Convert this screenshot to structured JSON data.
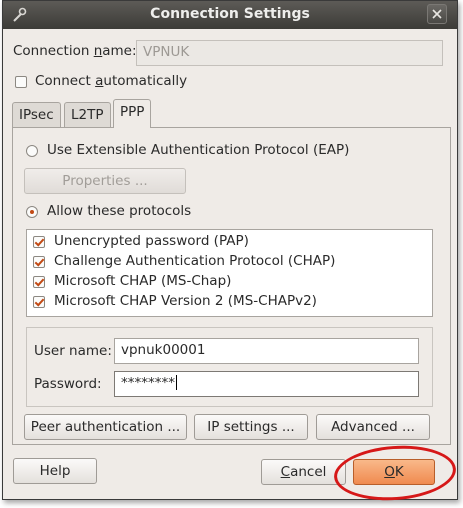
{
  "window": {
    "title": "Connection Settings",
    "title_icon": "tool-icon",
    "close_icon": "close-icon"
  },
  "connection_name": {
    "label_pre": "Connection ",
    "label_ul": "n",
    "label_post": "ame:",
    "value": "VPNUK"
  },
  "connect_auto": {
    "label_pre": "Connect ",
    "label_ul": "a",
    "label_post": "utomatically",
    "checked": false
  },
  "tabs": [
    {
      "label": "IPsec",
      "active": false
    },
    {
      "label": "L2TP",
      "active": false
    },
    {
      "label": "PPP",
      "active": true
    }
  ],
  "auth": {
    "eap_label": "Use Extensible Authentication Protocol (EAP)",
    "eap_selected": false,
    "properties_button": "Properties ...",
    "allow_label": "Allow these protocols",
    "allow_selected": true
  },
  "protocols": [
    {
      "label": "Unencrypted password (PAP)",
      "checked": true
    },
    {
      "label": "Challenge Authentication Protocol (CHAP)",
      "checked": true
    },
    {
      "label": "Microsoft CHAP (MS-Chap)",
      "checked": true
    },
    {
      "label": "Microsoft CHAP Version 2 (MS-CHAPv2)",
      "checked": true
    }
  ],
  "credentials": {
    "user_label": "User name:",
    "user_value": "vpnuk00001",
    "password_label": "Password:",
    "password_value": "********"
  },
  "panel_buttons": {
    "peer": "Peer authentication ...",
    "ip": "IP settings ...",
    "advanced": "Advanced ..."
  },
  "footer": {
    "help": "Help",
    "cancel_ul": "C",
    "cancel_rest": "ancel",
    "ok_ul": "O",
    "ok_rest": "K"
  },
  "colors": {
    "accent": "#c24a15",
    "ok_button": "#f08a4f",
    "highlight_ring": "#d61818"
  }
}
